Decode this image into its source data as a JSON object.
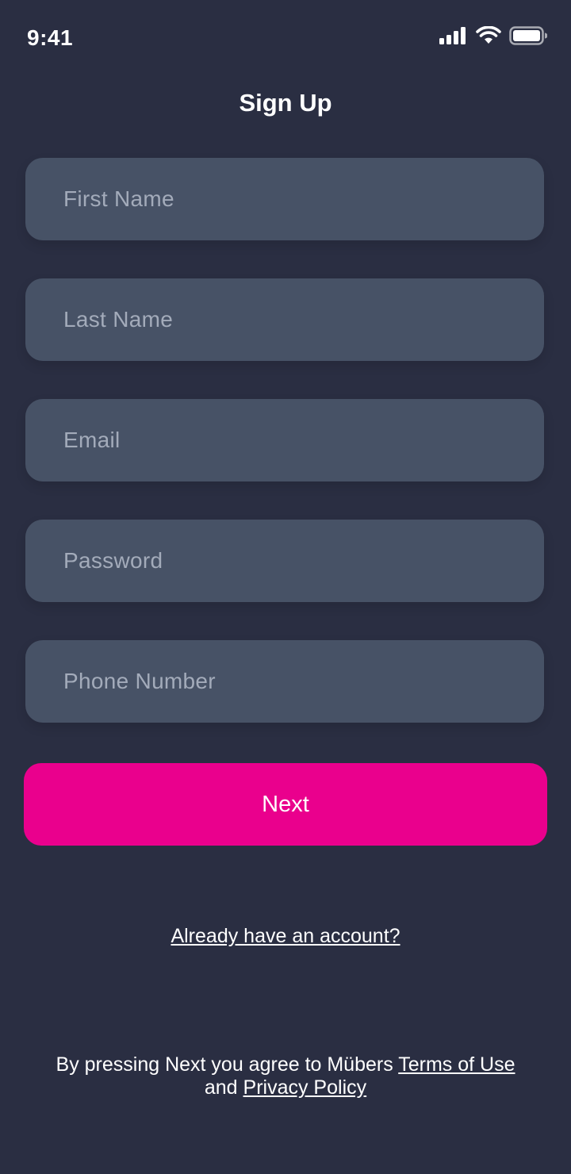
{
  "status_bar": {
    "time": "9:41",
    "icons": [
      "cellular-signal-icon",
      "wifi-icon",
      "battery-icon"
    ]
  },
  "header": {
    "title": "Sign Up"
  },
  "form": {
    "first_name": {
      "placeholder": "First Name",
      "value": ""
    },
    "last_name": {
      "placeholder": "Last Name",
      "value": ""
    },
    "email": {
      "placeholder": "Email",
      "value": ""
    },
    "password": {
      "placeholder": "Password",
      "value": ""
    },
    "phone_number": {
      "placeholder": "Phone Number",
      "value": ""
    }
  },
  "actions": {
    "next_label": "Next",
    "login_link": "Already have an account?"
  },
  "legal": {
    "prefix": "By pressing Next you agree to Mübers ",
    "terms_link": "Terms of Use",
    "conjunction": "and ",
    "privacy_link": "Privacy Policy"
  },
  "colors": {
    "background": "#2a2e42",
    "field": "#475266",
    "placeholder": "#a3abba",
    "accent": "#ea008d",
    "text": "#ffffff"
  }
}
